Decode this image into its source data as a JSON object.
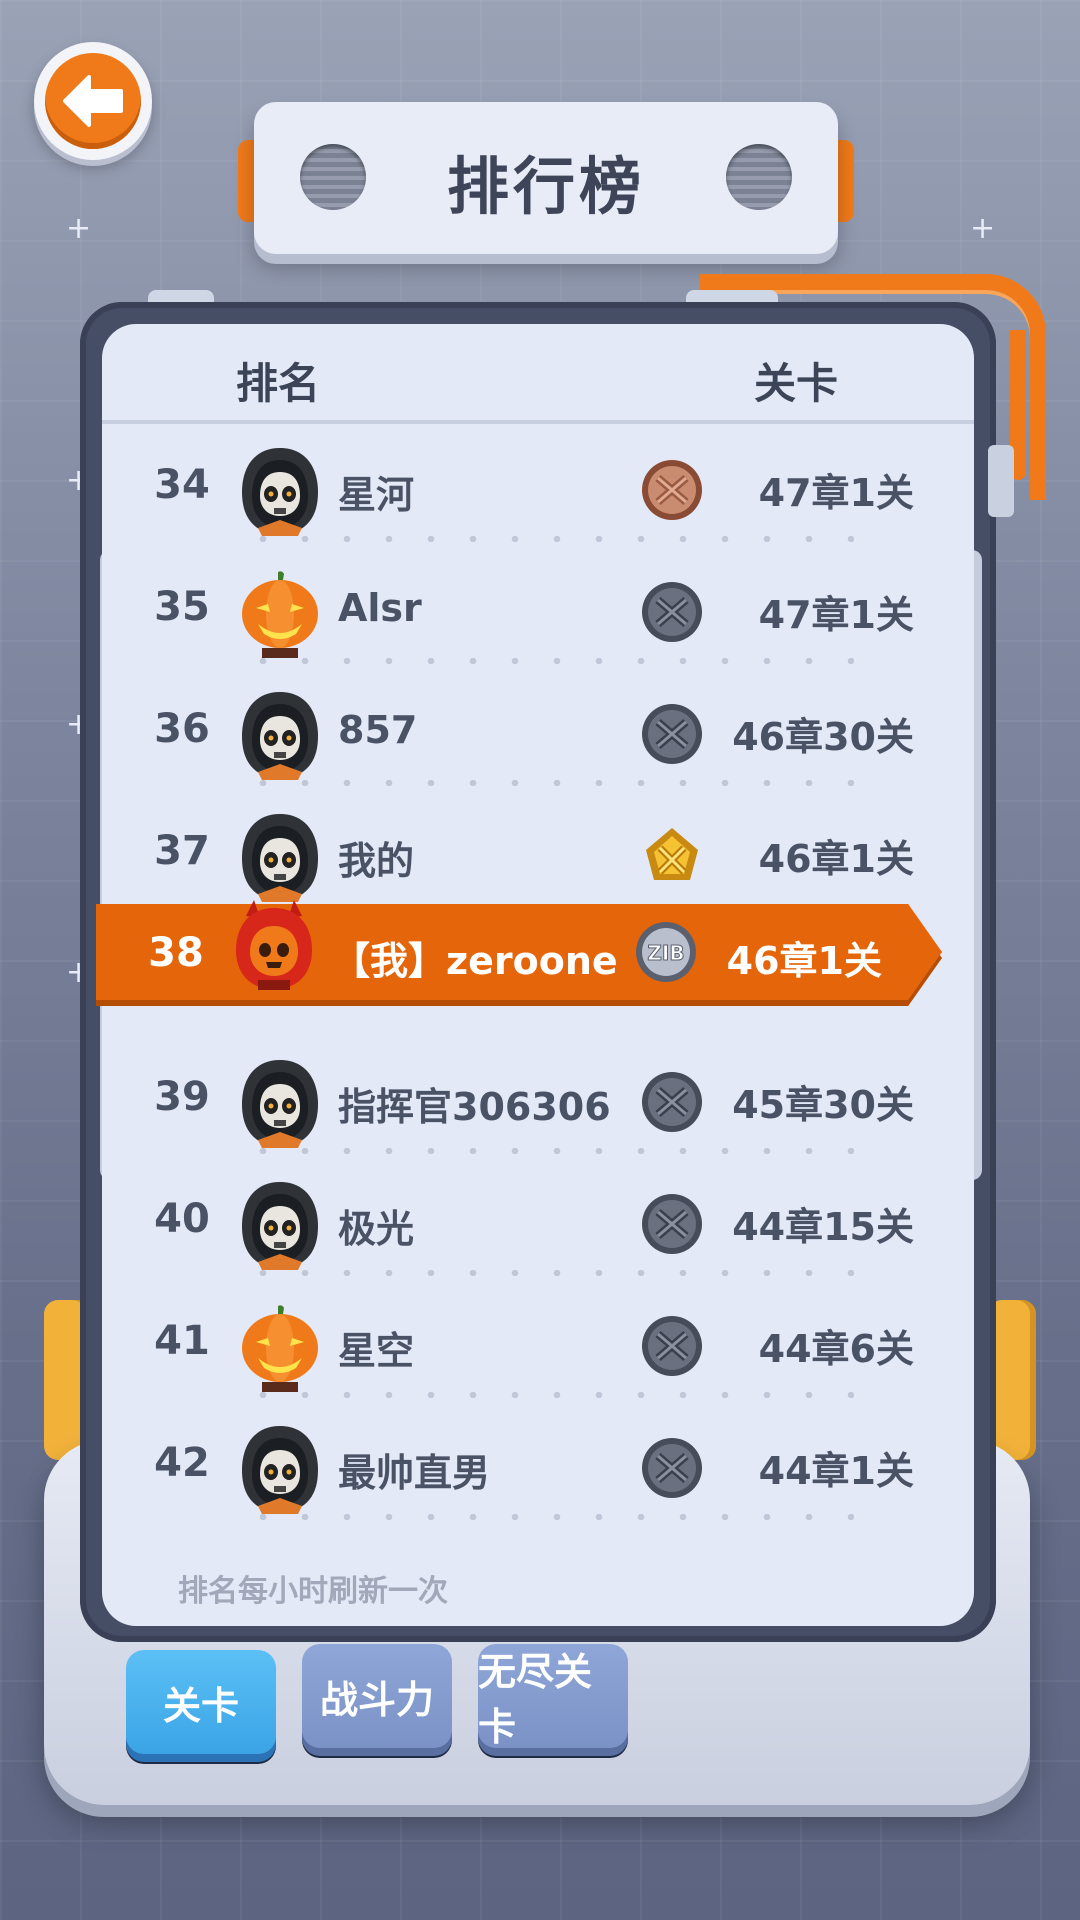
{
  "title": "排行榜",
  "columns": {
    "rank": "排名",
    "level": "关卡"
  },
  "rows": [
    {
      "rank": "34",
      "name": "星河",
      "level": "47章1关",
      "avatar": "reaper-avatar",
      "medal": "bronze-medal-icon"
    },
    {
      "rank": "35",
      "name": "Alsr",
      "level": "47章1关",
      "avatar": "pumpkin-avatar",
      "medal": "iron-medal-icon"
    },
    {
      "rank": "36",
      "name": "857",
      "level": "46章30关",
      "avatar": "reaper-avatar",
      "medal": "iron-medal-icon"
    },
    {
      "rank": "37",
      "name": "我的",
      "level": "46章1关",
      "avatar": "reaper-avatar",
      "medal": "gold-medal-icon"
    }
  ],
  "me": {
    "rank": "38",
    "name": "【我】zeroone",
    "level": "46章1关",
    "avatar": "devil-avatar",
    "medal": "silver-zib-medal-icon",
    "medal_text": "ZIB"
  },
  "rows_after": [
    {
      "rank": "39",
      "name": "指挥官306306",
      "level": "45章30关",
      "avatar": "reaper-avatar",
      "medal": "iron-medal-icon"
    },
    {
      "rank": "40",
      "name": "极光",
      "level": "44章15关",
      "avatar": "reaper-avatar",
      "medal": "iron-medal-icon"
    },
    {
      "rank": "41",
      "name": "星空",
      "level": "44章6关",
      "avatar": "pumpkin-avatar",
      "medal": "iron-medal-icon"
    },
    {
      "rank": "42",
      "name": "最帅直男",
      "level": "44章1关",
      "avatar": "reaper-avatar",
      "medal": "iron-medal-icon"
    }
  ],
  "footnote": "排名每小时刷新一次",
  "tabs": [
    {
      "label": "关卡",
      "active": true
    },
    {
      "label": "战斗力",
      "active": false
    },
    {
      "label": "无尽关卡",
      "active": false
    }
  ],
  "colors": {
    "accent": "#e5650a",
    "panel": "#e3e9f7",
    "frame": "#464e66",
    "tab_active": "#3aa4e6",
    "tab_idle": "#7b92c6"
  }
}
